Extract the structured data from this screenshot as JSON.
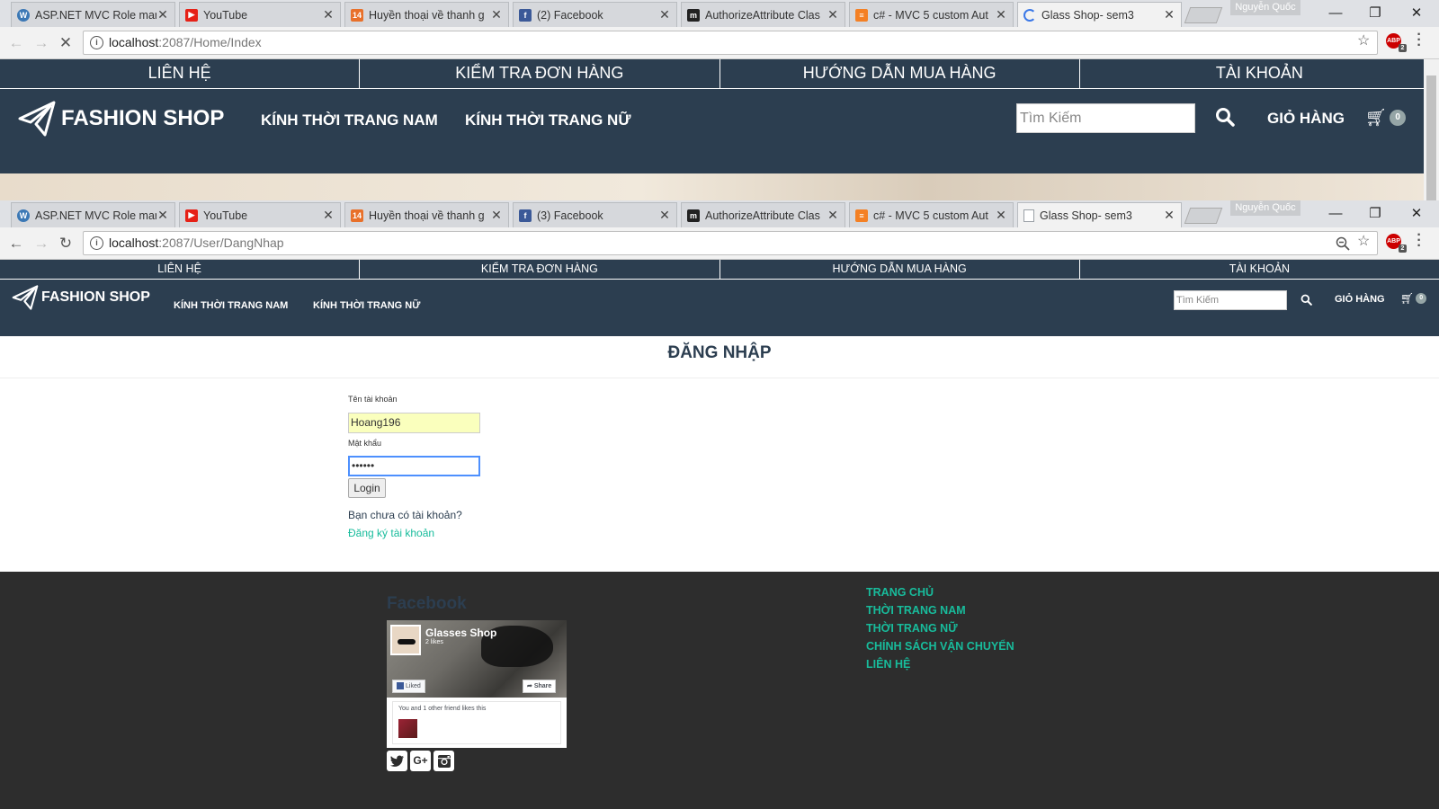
{
  "window1": {
    "tabs": [
      {
        "title": "ASP.NET MVC Role mar",
        "icon": "wordpress-icon",
        "icon_color": "#3b78b5"
      },
      {
        "title": "YouTube",
        "icon": "youtube-icon",
        "icon_color": "#e62117"
      },
      {
        "title": "Huyền thoại về thanh g",
        "icon": "news-icon",
        "icon_color": "#e8702a"
      },
      {
        "title": "(2) Facebook",
        "icon": "facebook-icon",
        "icon_color": "#3b5998"
      },
      {
        "title": "AuthorizeAttribute Clas",
        "icon": "msdn-icon",
        "icon_color": "#222222"
      },
      {
        "title": "c# - MVC 5 custom Aut",
        "icon": "stackoverflow-icon",
        "icon_color": "#f48024"
      },
      {
        "title": "Glass Shop- sem3",
        "icon": "loading-spinner-icon",
        "icon_color": "#3b78e7"
      }
    ],
    "profile": "Nguyễn Quốc",
    "url_host": "localhost",
    "url_path": ":2087/Home/Index",
    "abp_count": "2"
  },
  "window2": {
    "tabs": [
      {
        "title": "ASP.NET MVC Role mar",
        "icon": "wordpress-icon",
        "icon_color": "#3b78b5"
      },
      {
        "title": "YouTube",
        "icon": "youtube-icon",
        "icon_color": "#e62117"
      },
      {
        "title": "Huyền thoại về thanh g",
        "icon": "news-icon",
        "icon_color": "#e8702a"
      },
      {
        "title": "(3) Facebook",
        "icon": "facebook-icon",
        "icon_color": "#3b5998"
      },
      {
        "title": "AuthorizeAttribute Clas",
        "icon": "msdn-icon",
        "icon_color": "#222222"
      },
      {
        "title": "c# - MVC 5 custom Aut",
        "icon": "stackoverflow-icon",
        "icon_color": "#f48024"
      },
      {
        "title": "Glass Shop- sem3",
        "icon": "page-icon",
        "icon_color": "#9aa0a6"
      }
    ],
    "profile": "Nguyễn Quốc",
    "url_host": "localhost",
    "url_path": ":2087/User/DangNhap",
    "abp_count": "2"
  },
  "site": {
    "topnav": [
      "LIÊN HỆ",
      "KIỂM TRA ĐƠN HÀNG",
      "HƯỚNG DẪN MUA HÀNG",
      "TÀI KHOẢN"
    ],
    "brand": "FASHION SHOP",
    "nav_men": "KÍNH THỜI TRANG NAM",
    "nav_women": "KÍNH THỜI TRANG NỮ",
    "search_placeholder": "Tìm Kiếm",
    "cart_label": "GIỎ HÀNG",
    "cart_count": "0",
    "primary_color": "#2c3e50",
    "accent_color": "#18bc9c"
  },
  "login": {
    "title": "ĐĂNG NHẬP",
    "username_label": "Tên tài khoản",
    "username_value": "Hoang196",
    "password_label": "Mật khẩu",
    "password_value": "••••••",
    "login_button": "Login",
    "no_account_text": "Bạn chưa có tài khoản?",
    "register_link": "Đăng ký tài khoản"
  },
  "footer": {
    "facebook_heading": "Facebook",
    "fb_page_name": "Glasses Shop",
    "fb_likes": "2 likes",
    "fb_liked_btn": "Liked",
    "fb_share_btn": "Share",
    "fb_friends_text": "You and 1 other friend likes this",
    "social_icons": [
      "twitter-icon",
      "google-plus-icon",
      "instagram-icon"
    ],
    "links": [
      "TRANG CHỦ",
      "THỜI TRANG NAM",
      "THỜI TRANG NỮ",
      "CHÍNH SÁCH VẬN CHUYỂN",
      "LIÊN HỆ"
    ]
  }
}
